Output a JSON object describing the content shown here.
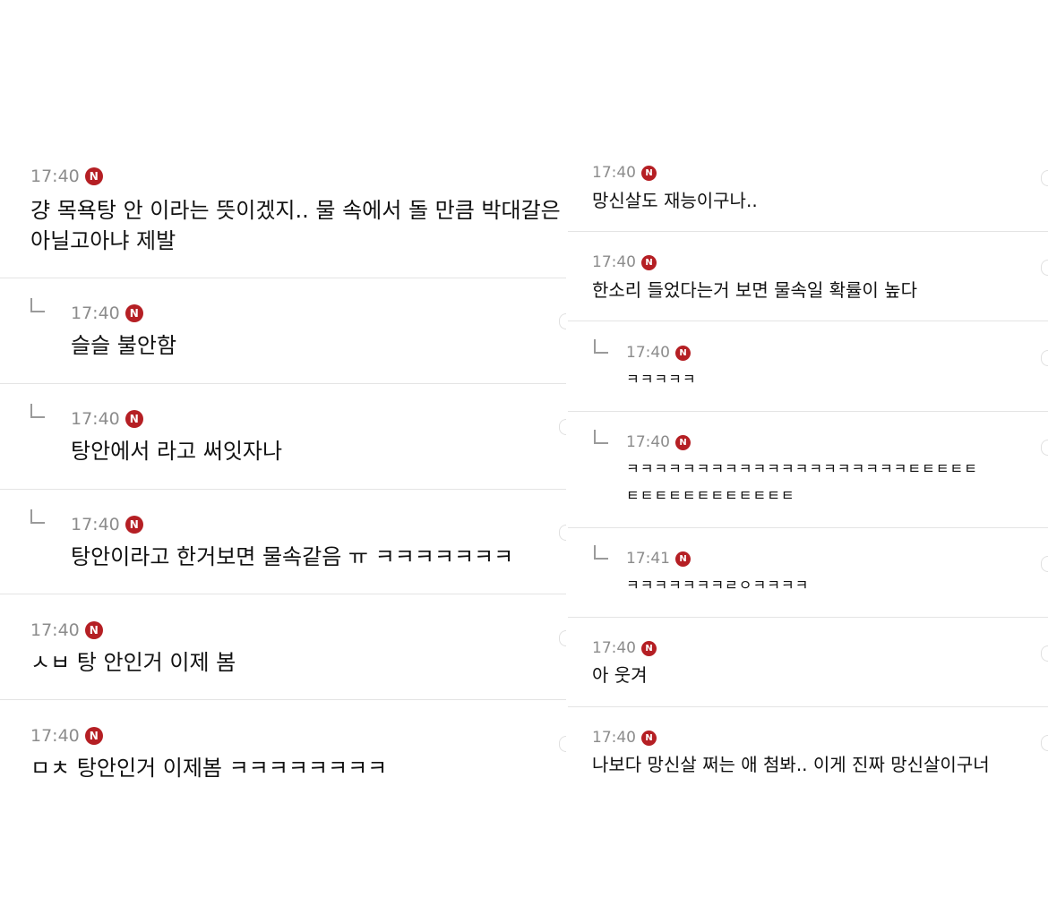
{
  "left_panel": {
    "comments": [
      {
        "time": "17:40",
        "badge": "N",
        "text_lines": [
          "걍 목욕탕 안 이라는 뜻이겠지.. 물 속에서 돌 만큼 박대갈은",
          "아닐고아냐 제발"
        ]
      },
      {
        "time": "17:40",
        "badge": "N",
        "text_lines": [
          "슬슬 불안함"
        ]
      },
      {
        "time": "17:40",
        "badge": "N",
        "text_lines": [
          "탕안에서 라고 써잇자나"
        ]
      },
      {
        "time": "17:40",
        "badge": "N",
        "text_lines": [
          "탕안이라고 한거보면 물속같음 ㅠ ㅋㅋㅋㅋㅋㅋㅋ"
        ]
      },
      {
        "time": "17:40",
        "badge": "N",
        "text_lines": [
          "ㅅㅂ 탕 안인거 이제 봄"
        ]
      },
      {
        "time": "17:40",
        "badge": "N",
        "text_lines": [
          "ㅁㅊ 탕안인거 이제봄 ㅋㅋㅋㅋㅋㅋㅋㅋ"
        ]
      }
    ]
  },
  "right_panel": {
    "comments": [
      {
        "time": "17:40",
        "badge": "N",
        "text_lines": [
          "망신살도 재능이구나.."
        ]
      },
      {
        "time": "17:40",
        "badge": "N",
        "text_lines": [
          "한소리 들었다는거 보면 물속일 확률이 높다"
        ]
      },
      {
        "time": "17:40",
        "badge": "N",
        "text_lines": [
          "ㅋㅋㅋㅋㅋ"
        ]
      },
      {
        "time": "17:40",
        "badge": "N",
        "text_lines": [
          "ㅋㅋㅋㅋㅋㅋㅋㅋㅋㅋㅋㅋㅋㅋㅋㅋㅋㅋㅋㅋㅌㅌㅌㅌㅌ",
          "ㅌㅌㅌㅌㅌㅌㅌㅌㅌㅌㅌㅌ"
        ]
      },
      {
        "time": "17:41",
        "badge": "N",
        "text_lines": [
          "ㅋㅋㅋㅋㅋㅋㅋㄹㅇㅋㅋㅋㅋ"
        ]
      },
      {
        "time": "17:40",
        "badge": "N",
        "text_lines": [
          "아 웃겨"
        ]
      },
      {
        "time": "17:40",
        "badge": "N",
        "text_lines": [
          "나보다 망신살 쩌는 애 첨봐.. 이게 진짜 망신살이구너"
        ]
      }
    ]
  }
}
